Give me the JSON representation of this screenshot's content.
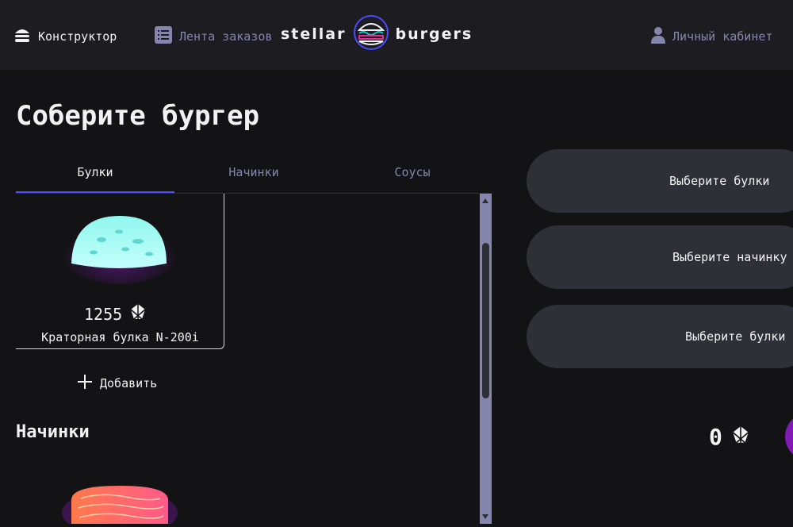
{
  "header": {
    "nav_constructor": "Конструктор",
    "nav_orders": "Лента заказов",
    "logo_left": "stellar",
    "logo_right": "burgers",
    "nav_account": "Личный кабинет"
  },
  "main": {
    "title": "Соберите бургер",
    "tabs": [
      {
        "label": "Булки"
      },
      {
        "label": "Начинки"
      },
      {
        "label": "Соусы"
      }
    ],
    "ingredient": {
      "price": "1255",
      "name": "Краторная булка N-200i",
      "add_label": "Добавить"
    },
    "section_fillings": "Начинки"
  },
  "constructor": {
    "slot_top": "Выберите булки",
    "slot_middle": "Выберите начинку",
    "slot_bottom": "Выберите булки",
    "total": "0"
  },
  "colors": {
    "accent": "#4c4cff",
    "muted": "#8585ad",
    "button": "#801ab2"
  }
}
